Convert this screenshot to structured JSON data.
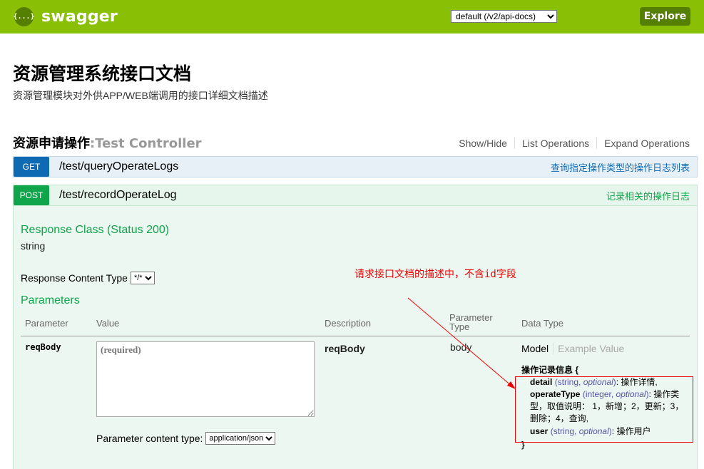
{
  "header": {
    "logo_icon": "{...}",
    "logo_text": "swagger",
    "api_select_value": "default (/v2/api-docs)",
    "explore_label": "Explore",
    "brand_color": "#89bf04"
  },
  "info": {
    "title": "资源管理系统接口文档",
    "description": "资源管理模块对外供APP/WEB端调用的接口详细文档描述"
  },
  "resource": {
    "name": "资源申请操作",
    "separator": ":",
    "controller": "Test Controller",
    "links": [
      "Show/Hide",
      "List Operations",
      "Expand Operations"
    ]
  },
  "operations": [
    {
      "method": "GET",
      "path": "/test/queryOperateLogs",
      "summary": "查询指定操作类型的操作日志列表",
      "color": "#0f6ab4"
    },
    {
      "method": "POST",
      "path": "/test/recordOperateLog",
      "summary": "记录相关的操作日志",
      "color": "#10a54a"
    }
  ],
  "post_detail": {
    "response_class_label": "Response Class (Status 200)",
    "response_class_value": "string",
    "response_content_type_label": "Response Content Type",
    "response_content_type_value": "*/*",
    "parameters_label": "Parameters",
    "table_headers": [
      "Parameter",
      "Value",
      "Description",
      "Parameter Type",
      "Data Type"
    ],
    "param": {
      "name": "reqBody",
      "value_placeholder": "(required)",
      "description": "reqBody",
      "param_type": "body",
      "content_type_label": "Parameter content type:",
      "content_type_value": "application/json"
    },
    "model_tabs": [
      "Model",
      "Example Value"
    ],
    "model": {
      "name": "操作记录信息",
      "open": "{",
      "close": "}",
      "properties": [
        {
          "name": "detail",
          "type": "string",
          "opt": "optional",
          "desc": "操作详情,"
        },
        {
          "name": "operateType",
          "type": "integer",
          "opt": "optional",
          "desc": "操作类型，取值说明： 1，新增；2，更新；3，删除；4，查询,"
        },
        {
          "name": "user",
          "type": "string",
          "opt": "optional",
          "desc": "操作用户"
        }
      ]
    }
  },
  "annotation": {
    "text": "请求接口文档的描述中，不含id字段",
    "color": "#ee0000"
  }
}
